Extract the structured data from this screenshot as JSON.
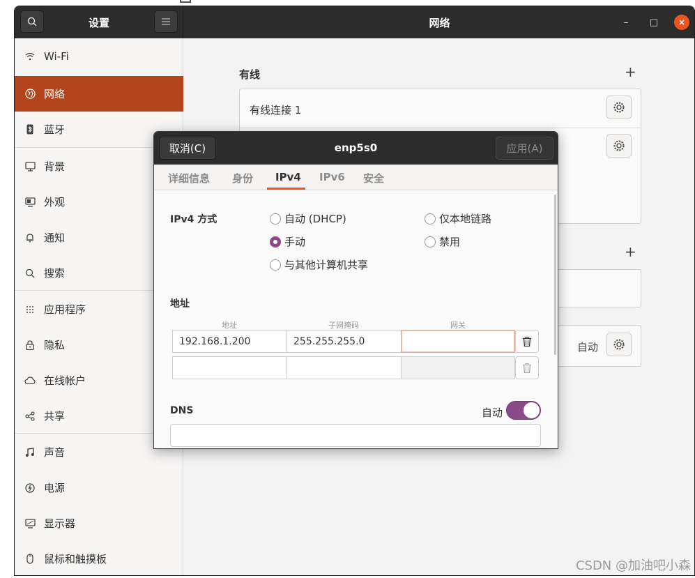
{
  "app": {
    "sidebar_title": "设置",
    "main_title": "网络",
    "window_controls": {
      "minimize": "–",
      "maximize": "□",
      "close": "×"
    }
  },
  "sidebar": {
    "items": [
      {
        "label": "Wi-Fi",
        "icon": "wifi-icon"
      },
      {
        "label": "网络",
        "icon": "globe-icon",
        "active": true
      },
      {
        "label": "蓝牙",
        "icon": "bluetooth-icon"
      },
      {
        "label": "背景",
        "icon": "monitor-icon"
      },
      {
        "label": "外观",
        "icon": "appearance-icon"
      },
      {
        "label": "通知",
        "icon": "bell-icon"
      },
      {
        "label": "搜索",
        "icon": "search-icon"
      },
      {
        "label": "应用程序",
        "icon": "apps-grid-icon"
      },
      {
        "label": "隐私",
        "icon": "lock-icon"
      },
      {
        "label": "在线帐户",
        "icon": "cloud-icon"
      },
      {
        "label": "共享",
        "icon": "share-icon"
      },
      {
        "label": "声音",
        "icon": "music-note-icon"
      },
      {
        "label": "电源",
        "icon": "power-icon"
      },
      {
        "label": "显示器",
        "icon": "display-icon"
      },
      {
        "label": "鼠标和触摸板",
        "icon": "mouse-icon"
      }
    ]
  },
  "main": {
    "wired_title": "有线",
    "plus": "+",
    "wired_connection_label": "有线连接 1",
    "vpn_status": "自动"
  },
  "dialog": {
    "title": "enp5s0",
    "cancel_label": "取消(C)",
    "apply_label": "应用(A)",
    "tabs": [
      "详细信息",
      "身份",
      "IPv4",
      "IPv6",
      "安全"
    ],
    "active_tab": "IPv4",
    "ipv4": {
      "method_label": "IPv4 方式",
      "methods": {
        "dhcp": "自动 (DHCP)",
        "link_local": "仅本地链路",
        "manual": "手动",
        "disabled": "禁用",
        "shared": "与其他计算机共享"
      },
      "selected_method": "手动",
      "address_section": "地址",
      "col_address": "地址",
      "col_netmask": "子网掩码",
      "col_gateway": "网关",
      "rows": [
        {
          "address": "192.168.1.200",
          "netmask": "255.255.255.0",
          "gateway": ""
        },
        {
          "address": "",
          "netmask": "",
          "gateway": ""
        }
      ],
      "dns_label": "DNS",
      "dns_auto_label": "自动",
      "dns_auto_on": true,
      "dns_value": ""
    }
  },
  "watermark": "CSDN @加油吧小森",
  "colors": {
    "accent": "#e95420",
    "sidebar_active": "#b3441c",
    "toggle": "#8a4a88",
    "headerbar": "#2c2c2c"
  }
}
